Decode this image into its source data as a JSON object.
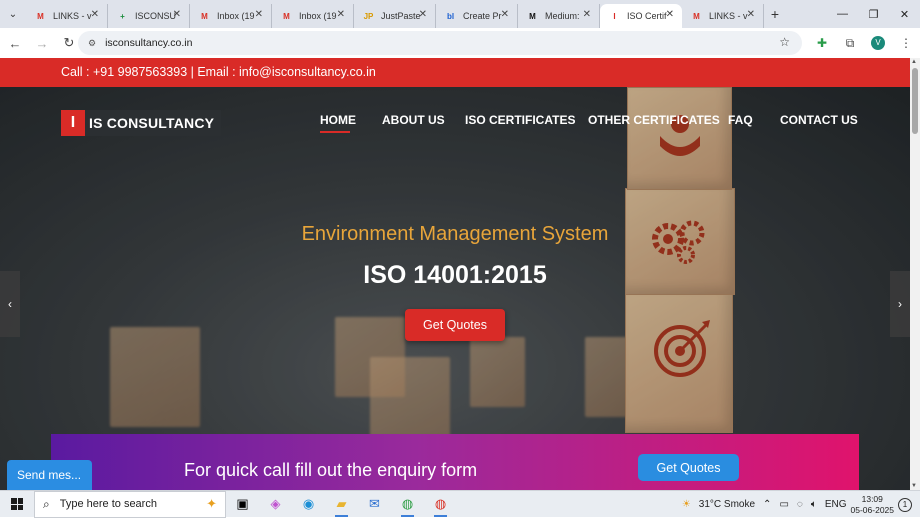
{
  "browser": {
    "tabs": [
      {
        "label": "LINKS - v",
        "favicon": "gmail-icon",
        "fav_text": "M",
        "fav_color": "#d93025",
        "active": false
      },
      {
        "label": "ISCONSU",
        "favicon": "sheets-icon",
        "fav_text": "+",
        "fav_color": "#1e8e3e",
        "active": false
      },
      {
        "label": "Inbox (19",
        "favicon": "gmail-icon",
        "fav_text": "M",
        "fav_color": "#d93025",
        "active": false
      },
      {
        "label": "Inbox (19",
        "favicon": "gmail-icon",
        "fav_text": "M",
        "fav_color": "#d93025",
        "active": false
      },
      {
        "label": "JustPaste",
        "favicon": "justpaste-icon",
        "fav_text": "JP",
        "fav_color": "#d99a00",
        "active": false
      },
      {
        "label": "Create Pr",
        "favicon": "blogger-icon",
        "fav_text": "bl",
        "fav_color": "#1a5fd0",
        "active": false
      },
      {
        "label": "Medium:",
        "favicon": "medium-icon",
        "fav_text": "M",
        "fav_color": "#111111",
        "active": false
      },
      {
        "label": "ISO Certif",
        "favicon": "isconsultancy-icon",
        "fav_text": "I",
        "fav_color": "#d92b27",
        "active": true
      },
      {
        "label": "LINKS - v",
        "favicon": "gmail-icon",
        "fav_text": "M",
        "fav_color": "#d93025",
        "active": false
      }
    ],
    "url": "isconsultancy.co.in",
    "profile_initial": "V"
  },
  "site": {
    "contact_bar": "Call : +91 9987563393 | Email : info@isconsultancy.co.in",
    "logo_mark": "I",
    "logo_text": "IS CONSULTANCY",
    "nav": [
      "HOME",
      "ABOUT US",
      "ISO CERTIFICATES",
      "OTHER CERTIFICATES",
      "FAQ",
      "CONTACT US"
    ],
    "hero_subtitle": "Environment Management System",
    "hero_title": "ISO 14001:2015",
    "hero_button": "Get Quotes",
    "prev_arrow": "‹",
    "next_arrow": "›",
    "enquiry_text": "For quick call fill out the enquiry form",
    "enquiry_button": "Get Quotes",
    "send_message": "Send mes..."
  },
  "taskbar": {
    "search_placeholder": "Type here to search",
    "weather": "31°C  Smoke",
    "language": "ENG",
    "time": "13:09",
    "date": "05-06-2025",
    "notifications": "1"
  },
  "colors": {
    "brand_red": "#d92b27",
    "heading_orange": "#e8a53a",
    "band_purple": "#5a1aa0",
    "band_pink": "#e0136c",
    "button_blue": "#2a8de0"
  }
}
